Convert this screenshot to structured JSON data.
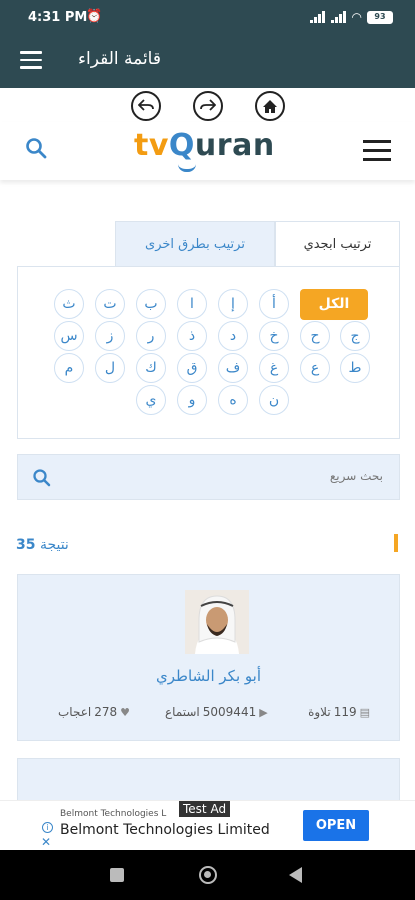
{
  "status_bar": {
    "time": "4:31 PM",
    "battery": "93"
  },
  "app_bar": {
    "title": "قائمة القراء"
  },
  "logo": {
    "part1": "tv",
    "part2": "Q",
    "part3": "uran"
  },
  "tabs": {
    "alphabetical": "ترتيب ابجدي",
    "other": "ترتيب بطرق اخرى"
  },
  "letters": {
    "all_label": "الكل",
    "row1": [
      "أ",
      "إ",
      "ا",
      "ب",
      "ت",
      "ث"
    ],
    "row2": [
      "ج",
      "ح",
      "خ",
      "د",
      "ذ",
      "ر",
      "ز",
      "س",
      "ش",
      "ص"
    ],
    "row3": [
      "ط",
      "ع",
      "غ",
      "ف",
      "ق",
      "ك",
      "ل",
      "م"
    ],
    "row4": [
      "ن",
      "ه",
      "و",
      "ي"
    ]
  },
  "quick_search": {
    "placeholder": "بحث سريع"
  },
  "results": {
    "count": "35",
    "label": "نتيجة"
  },
  "reader": {
    "name": "أبو بكر الشاطري",
    "tilawa_count": "119",
    "tilawa_label": "تلاوة",
    "listen_count": "5009441",
    "listen_label": "استماع",
    "like_count": "278",
    "like_label": "اعجاب"
  },
  "ad": {
    "label": "Test Ad",
    "small_text": "Belmont Technologies L",
    "title": "Belmont Technologies Limited",
    "cta": "OPEN"
  },
  "colors": {
    "primary_dark": "#2e4a52",
    "accent_blue": "#3b87c9",
    "accent_orange": "#f5a623"
  }
}
